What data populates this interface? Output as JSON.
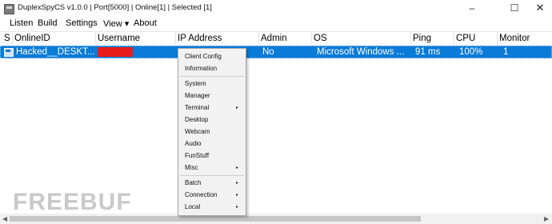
{
  "window": {
    "title": "DuplexSpyCS v1.0.0 | Port[5000] | Online[1] | Selected [1]",
    "controls": {
      "minimize": "–",
      "maximize": "☐",
      "close": "✕"
    }
  },
  "menubar": {
    "items": [
      "Listen",
      "Build",
      "Settings",
      "View ▾",
      "About"
    ]
  },
  "table": {
    "columns": [
      "S",
      "OnlineID",
      "Username",
      "IP Address",
      "Admin",
      "OS",
      "Ping",
      "CPU",
      "Monitor"
    ],
    "row": {
      "online_id": "Hacked__DESKT...",
      "admin": "No",
      "os": "Microsoft Windows ...",
      "ping": "91 ms",
      "cpu": "100%",
      "monitor": "1",
      "redaction_color": "#e81b1b",
      "selection_color": "#0a7bd6"
    }
  },
  "context_menu": {
    "items": [
      "Client Config",
      "Information",
      "System",
      "Manager",
      "Terminal",
      "Desktop",
      "Webcam",
      "Audio",
      "FunStuff",
      "Misc",
      "Batch",
      "Connection",
      "Local"
    ],
    "submenu_arrow": "▸"
  },
  "watermark": "FREEBUF"
}
